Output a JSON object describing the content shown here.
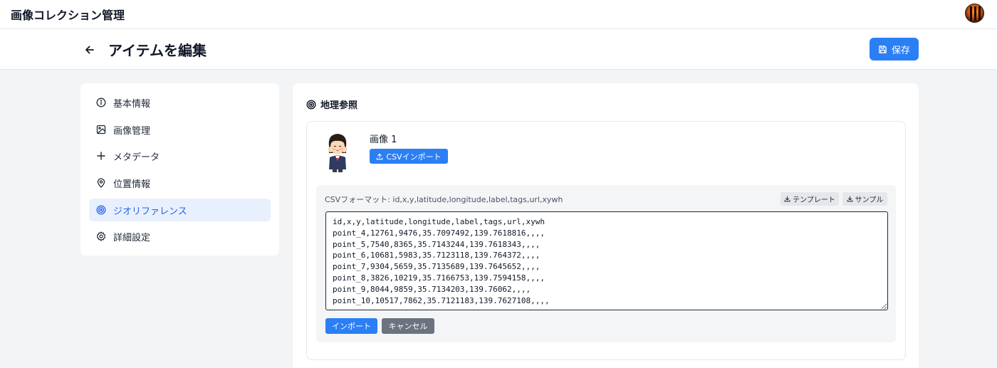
{
  "app": {
    "title": "画像コレクション管理"
  },
  "header": {
    "title": "アイテムを編集",
    "save_label": "保存"
  },
  "sidebar": {
    "items": [
      {
        "label": "基本情報",
        "icon": "info-icon",
        "active": false
      },
      {
        "label": "画像管理",
        "icon": "image-icon",
        "active": false
      },
      {
        "label": "メタデータ",
        "icon": "plus-icon",
        "active": false
      },
      {
        "label": "位置情報",
        "icon": "map-pin-icon",
        "active": false
      },
      {
        "label": "ジオリファレンス",
        "icon": "target-icon",
        "active": true
      },
      {
        "label": "詳細設定",
        "icon": "gear-icon",
        "active": false
      }
    ]
  },
  "georef": {
    "section_title": "地理参照",
    "image": {
      "name": "画像 1",
      "csv_import_label": "CSVインポート"
    },
    "csv": {
      "format_text": "CSVフォーマット: id,x,y,latitude,longitude,label,tags,url,xywh",
      "template_label": "テンプレート",
      "sample_label": "サンプル",
      "content": "id,x,y,latitude,longitude,label,tags,url,xywh\npoint_4,12761,9476,35.7097492,139.7618816,,,,\npoint_5,7540,8365,35.7143244,139.7618343,,,,\npoint_6,10681,5983,35.7123118,139.764372,,,,\npoint_7,9304,5659,35.7135689,139.7645652,,,,\npoint_8,3826,10219,35.7166753,139.7594158,,,,\npoint_9,8044,9859,35.7134203,139.76062,,,,\npoint_10,10517,7862,35.7121183,139.7627108,,,,",
      "import_label": "インポート",
      "cancel_label": "キャンセル"
    }
  },
  "colors": {
    "accent": "#2b7ff5",
    "active_bg": "#e8f0fd",
    "active_text": "#2563eb",
    "cancel": "#6b7280"
  }
}
